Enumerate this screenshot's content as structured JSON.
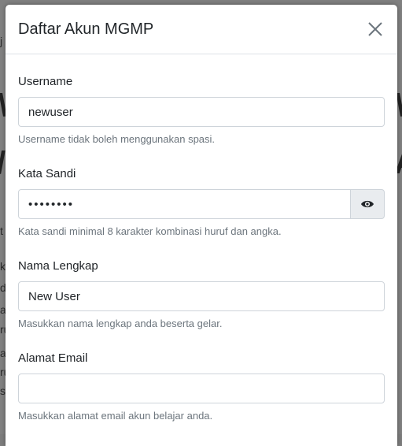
{
  "modal": {
    "title": "Daftar Akun MGMP",
    "close_icon": "close-icon"
  },
  "form": {
    "username": {
      "label": "Username",
      "value": "newuser",
      "help": "Username tidak boleh menggunakan spasi."
    },
    "password": {
      "label": "Kata Sandi",
      "value": "••••••••",
      "toggle_icon": "eye-icon",
      "help": "Kata sandi minimal 8 karakter kombinasi huruf dan angka."
    },
    "fullname": {
      "label": "Nama Lengkap",
      "value": "New User",
      "help": "Masukkan nama lengkap anda beserta gelar."
    },
    "email": {
      "label": "Alamat Email",
      "value": "",
      "help": "Masukkan alamat email akun belajar anda."
    }
  }
}
